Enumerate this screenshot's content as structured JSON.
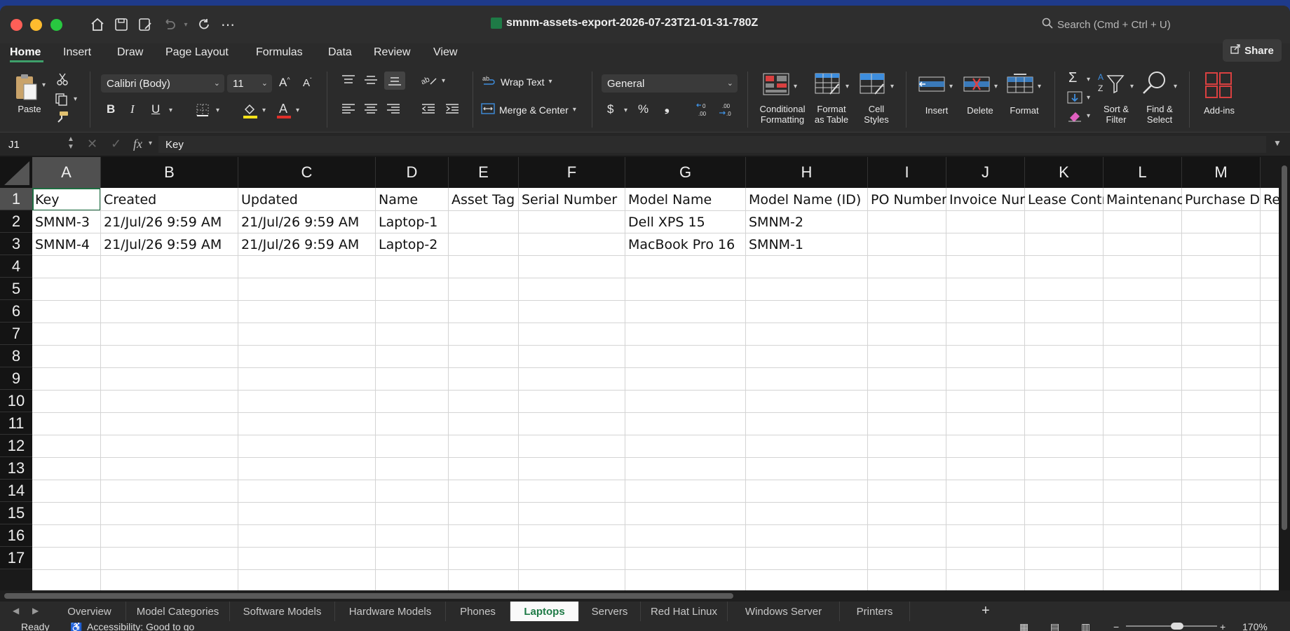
{
  "window": {
    "title": "smnm-assets-export-2026-07-23T21-01-31-780Z",
    "search_placeholder": "Search (Cmd + Ctrl + U)",
    "share_label": "Share"
  },
  "ribbon_tabs": [
    "Home",
    "Insert",
    "Draw",
    "Page Layout",
    "Formulas",
    "Data",
    "Review",
    "View"
  ],
  "active_ribbon_tab": "Home",
  "ribbon": {
    "paste": "Paste",
    "font_name": "Calibri (Body)",
    "font_size": "11",
    "wrap_text": "Wrap Text",
    "merge_center": "Merge & Center",
    "number_format": "General",
    "conditional_formatting": [
      "Conditional",
      "Formatting"
    ],
    "format_as_table": [
      "Format",
      "as Table"
    ],
    "cell_styles": [
      "Cell",
      "Styles"
    ],
    "insert": "Insert",
    "delete": "Delete",
    "format": "Format",
    "sort_filter": [
      "Sort &",
      "Filter"
    ],
    "find_select": [
      "Find &",
      "Select"
    ],
    "add_ins": "Add-ins",
    "bold": "B",
    "italic": "I",
    "underline": "U"
  },
  "formula_bar": {
    "name_box": "J1",
    "value": "Key"
  },
  "columns": [
    "A",
    "B",
    "C",
    "D",
    "E",
    "F",
    "G",
    "H",
    "I",
    "J",
    "K",
    "L",
    "M"
  ],
  "selected_column": "A",
  "rows": [
    "1",
    "2",
    "3",
    "4",
    "5",
    "6",
    "7",
    "8",
    "9",
    "10",
    "11",
    "12",
    "13",
    "14",
    "15",
    "16",
    "17"
  ],
  "selected_row": "1",
  "cells": [
    [
      "Key",
      "Created",
      "Updated",
      "Name",
      "Asset Tag",
      "Serial Number",
      "Model Name",
      "Model Name (ID)",
      "PO Number",
      "Invoice Number",
      "Lease Contract",
      "Maintenance",
      "Purchase Date",
      "Re"
    ],
    [
      "SMNM-3",
      "21/Jul/26 9:59 AM",
      "21/Jul/26 9:59 AM",
      "Laptop-1",
      "",
      "",
      "Dell XPS 15",
      "SMNM-2",
      "",
      "",
      "",
      "",
      "",
      ""
    ],
    [
      "SMNM-4",
      "21/Jul/26 9:59 AM",
      "21/Jul/26 9:59 AM",
      "Laptop-2",
      "",
      "",
      "MacBook Pro 16",
      "SMNM-1",
      "",
      "",
      "",
      "",
      "",
      ""
    ]
  ],
  "sheet_tabs": [
    "Overview",
    "Model Categories",
    "Software Models",
    "Hardware Models",
    "Phones",
    "Laptops",
    "Servers",
    "Red Hat Linux",
    "Windows Server",
    "Printers"
  ],
  "active_sheet": "Laptops",
  "status": {
    "ready": "Ready",
    "accessibility": "Accessibility: Good to go",
    "zoom": "170%"
  },
  "colors": {
    "accent_green": "#1e7a46",
    "ribbon_bg": "#2b2b2b",
    "red_light": "#ff5f57",
    "yellow_light": "#febc2e",
    "green_light": "#28c840"
  }
}
